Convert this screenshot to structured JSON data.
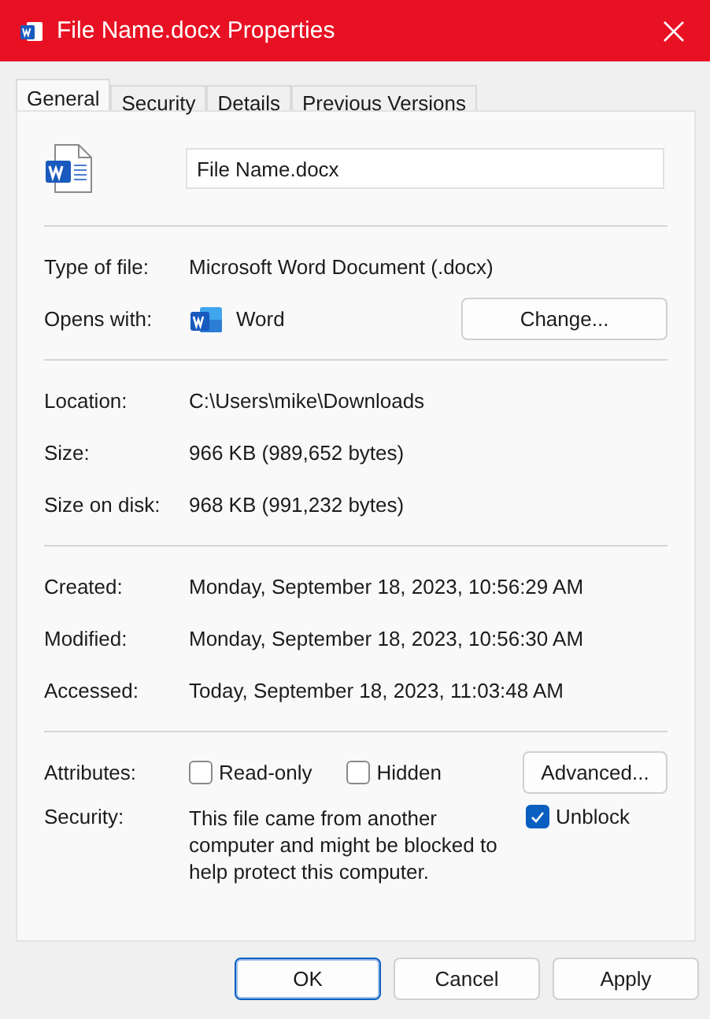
{
  "window": {
    "title": "File Name.docx Properties"
  },
  "tabs": [
    {
      "label": "General",
      "selected": true
    },
    {
      "label": "Security",
      "selected": false
    },
    {
      "label": "Details",
      "selected": false
    },
    {
      "label": "Previous Versions",
      "selected": false
    }
  ],
  "file_name": "File Name.docx",
  "groups": [
    [
      {
        "kind": "text",
        "label": "Type of file:",
        "value": "Microsoft Word Document (.docx)"
      },
      {
        "kind": "app",
        "label": "Opens with:",
        "value": "Word",
        "button": "Change..."
      }
    ],
    [
      {
        "kind": "text",
        "label": "Location:",
        "value": "C:\\Users\\mike\\Downloads"
      },
      {
        "kind": "text",
        "label": "Size:",
        "value": "966 KB (989,652 bytes)"
      },
      {
        "kind": "text",
        "label": "Size on disk:",
        "value": "968 KB (991,232 bytes)"
      }
    ],
    [
      {
        "kind": "text",
        "label": "Created:",
        "value": "Monday, September 18, 2023, 10:56:29 AM"
      },
      {
        "kind": "text",
        "label": "Modified:",
        "value": "Monday, September 18, 2023, 10:56:30 AM"
      },
      {
        "kind": "text",
        "label": "Accessed:",
        "value": "Today, September 18, 2023, 11:03:48 AM"
      }
    ],
    [
      {
        "kind": "attributes",
        "label": "Attributes:",
        "checks": [
          {
            "label": "Read-only",
            "checked": false
          },
          {
            "label": "Hidden",
            "checked": false
          }
        ],
        "button": "Advanced..."
      },
      {
        "kind": "security",
        "label": "Security:",
        "value": "This file came from another computer and might be blocked to help protect this computer.",
        "checks": [
          {
            "label": "Unblock",
            "checked": true
          }
        ]
      }
    ]
  ],
  "buttons": [
    {
      "label": "OK",
      "default": true
    },
    {
      "label": "Cancel",
      "default": false
    },
    {
      "label": "Apply",
      "default": false
    }
  ]
}
